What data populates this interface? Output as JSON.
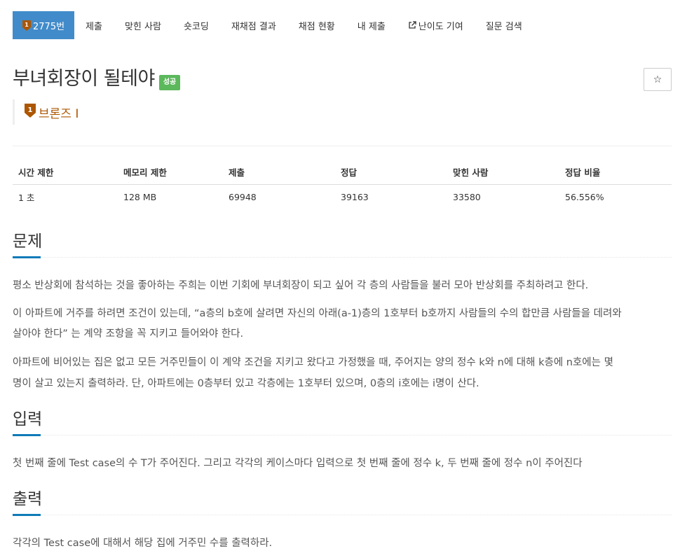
{
  "nav": {
    "problem_number": "2775번",
    "items": [
      "제출",
      "맞힌 사람",
      "숏코딩",
      "재채점 결과",
      "채점 현황",
      "내 제출"
    ],
    "difficulty_contrib": "난이도 기여",
    "question_search": "질문 검색"
  },
  "problem": {
    "title": "부녀회장이 될테야",
    "status_label": "성공",
    "tier": "브론즈 I",
    "tier_number": "1",
    "star": "☆"
  },
  "info": {
    "headers": [
      "시간 제한",
      "메모리 제한",
      "제출",
      "정답",
      "맞힌 사람",
      "정답 비율"
    ],
    "values": [
      "1 초",
      "128 MB",
      "69948",
      "39163",
      "33580",
      "56.556%"
    ]
  },
  "sections": {
    "problem_heading": "문제",
    "problem_p1": "평소 반상회에 참석하는 것을 좋아하는 주희는 이번 기회에 부녀회장이 되고 싶어 각 층의 사람들을 불러 모아 반상회를 주최하려고 한다.",
    "problem_p2_line1": "이 아파트에 거주를 하려면 조건이 있는데, “a층의 b호에 살려면 자신의 아래(a-1)층의 1호부터 b호까지 사람들의 수의 합만큼 사람들을 데려와",
    "problem_p2_line2": "살아야 한다” 는 계약 조항을 꼭 지키고 들어와야 한다.",
    "problem_p3_line1": "아파트에 비어있는 집은 없고 모든 거주민들이 이 계약 조건을 지키고 왔다고 가정했을 때, 주어지는 양의 정수 k와 n에 대해 k층에 n호에는 몇",
    "problem_p3_line2": "명이 살고 있는지 출력하라. 단, 아파트에는 0층부터 있고 각층에는 1호부터 있으며, 0층의 i호에는 i명이 산다.",
    "input_heading": "입력",
    "input_p": "첫 번째 줄에 Test case의 수 T가 주어진다. 그리고 각각의 케이스마다 입력으로 첫 번째 줄에 정수 k, 두 번째 줄에 정수 n이 주어진다",
    "output_heading": "출력",
    "output_p": "각각의 Test case에 대해서 해당 집에 거주민 수를 출력하라."
  },
  "colors": {
    "active_tab": "#428bca",
    "success": "#5cb85c",
    "bronze": "#ad5600",
    "section_underline": "#0f7bb8"
  }
}
